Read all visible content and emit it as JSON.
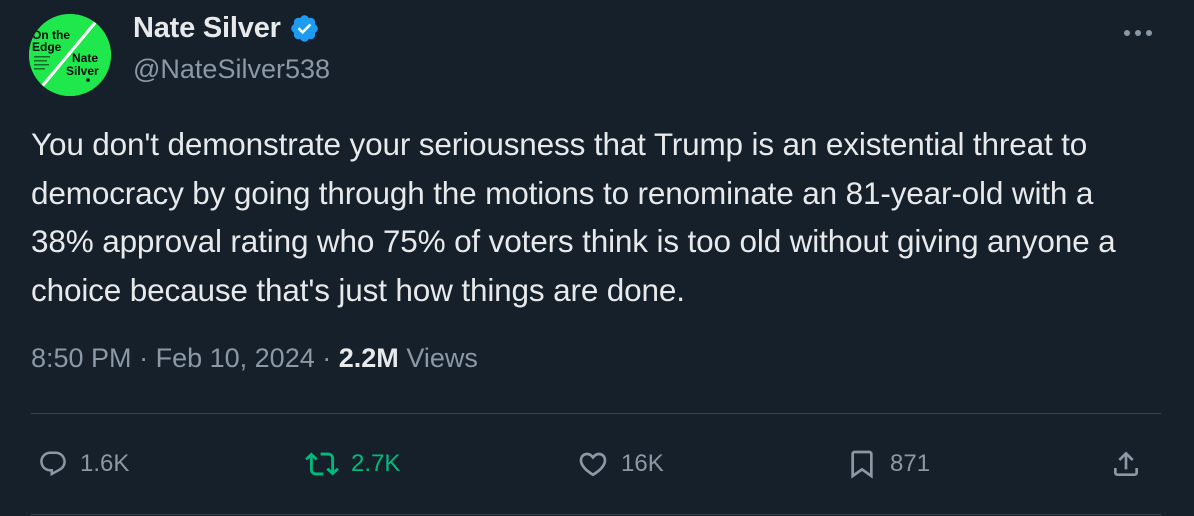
{
  "author": {
    "display_name": "Nate Silver",
    "handle": "@NateSilver538",
    "avatar_text": [
      "On the",
      "Edge",
      "Nate",
      "Silver"
    ]
  },
  "tweet": {
    "text": "You don't demonstrate your seriousness that Trump is an existential threat to democracy by going through the motions to renominate an 81-year-old with a 38% approval rating who 75% of voters think is too old without giving anyone a choice because that's just how things are done.",
    "time": "8:50 PM",
    "date": "Feb 10, 2024",
    "views_count": "2.2M",
    "views_label": "Views",
    "separator": "·"
  },
  "actions": {
    "reply_count": "1.6K",
    "retweet_count": "2.7K",
    "like_count": "16K",
    "bookmark_count": "871"
  },
  "colors": {
    "background": "#15202b",
    "text": "#e7e9ea",
    "secondary": "#8b98a5",
    "verified": "#1d9bf0",
    "retweet": "#00ba7c",
    "avatar": "#1ee84c"
  },
  "icons": [
    "verified-badge-icon",
    "more-icon",
    "reply-icon",
    "retweet-icon",
    "like-icon",
    "bookmark-icon",
    "share-icon"
  ]
}
